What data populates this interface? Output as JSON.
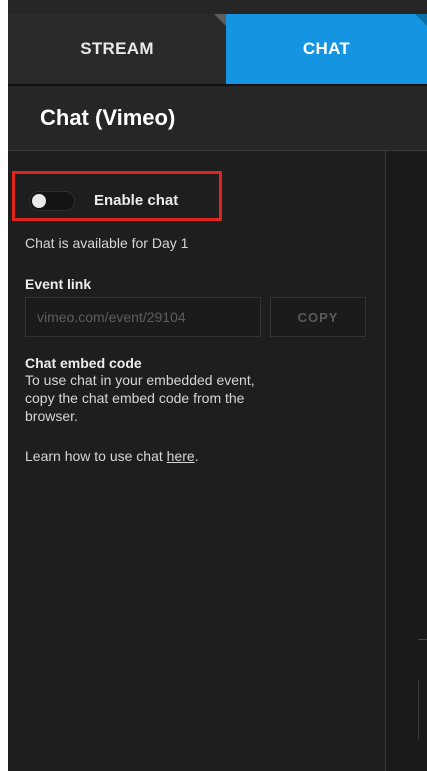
{
  "tabs": [
    {
      "label": "STREAM",
      "active": false
    },
    {
      "label": "CHAT",
      "active": true
    }
  ],
  "header": {
    "title": "Chat (Vimeo)"
  },
  "chat": {
    "toggle_label": "Enable chat",
    "toggle_state": "off",
    "availability": "Chat is available for Day 1",
    "event_link_label": "Event link",
    "event_link_value": "vimeo.com/event/29104",
    "copy_label": "COPY",
    "embed_title": "Chat embed code",
    "embed_lines": [
      "To use chat in your embedded event,",
      "copy the chat embed code from the",
      "browser."
    ],
    "learn_prefix": "Learn how to use chat ",
    "learn_link": "here",
    "learn_suffix": "."
  },
  "colors": {
    "accent": "#1594e1",
    "highlight": "#e0241b",
    "background": "#1e1e1e"
  },
  "icons": [
    "tab-corner-icon"
  ]
}
